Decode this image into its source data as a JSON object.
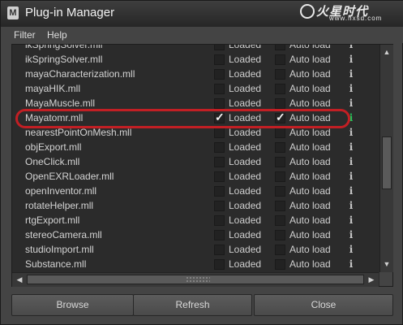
{
  "window": {
    "title": "Plug-in Manager"
  },
  "watermark": {
    "text": "火星时代",
    "url": "www.hxsd.com"
  },
  "menubar": {
    "items": [
      {
        "label": "Filter"
      },
      {
        "label": "Help"
      }
    ]
  },
  "plugins": [
    {
      "name": "ikSpringSolver.mll",
      "loaded": false,
      "auto_load": false,
      "loaded_label": "Loaded",
      "auto_label": "Auto load",
      "info_color": "#c8c8c8"
    },
    {
      "name": "ikSpringSolver.mll",
      "loaded": false,
      "auto_load": false,
      "loaded_label": "Loaded",
      "auto_label": "Auto load",
      "info_color": "#c8c8c8"
    },
    {
      "name": "mayaCharacterization.mll",
      "loaded": false,
      "auto_load": false,
      "loaded_label": "Loaded",
      "auto_label": "Auto load",
      "info_color": "#c8c8c8"
    },
    {
      "name": "mayaHIK.mll",
      "loaded": false,
      "auto_load": false,
      "loaded_label": "Loaded",
      "auto_label": "Auto load",
      "info_color": "#c8c8c8"
    },
    {
      "name": "MayaMuscle.mll",
      "loaded": false,
      "auto_load": false,
      "loaded_label": "Loaded",
      "auto_label": "Auto load",
      "info_color": "#c8c8c8"
    },
    {
      "name": "Mayatomr.mll",
      "loaded": true,
      "auto_load": true,
      "loaded_label": "Loaded",
      "auto_label": "Auto load",
      "info_color": "#22c35a"
    },
    {
      "name": "nearestPointOnMesh.mll",
      "loaded": false,
      "auto_load": false,
      "loaded_label": "Loaded",
      "auto_label": "Auto load",
      "info_color": "#c8c8c8"
    },
    {
      "name": "objExport.mll",
      "loaded": false,
      "auto_load": false,
      "loaded_label": "Loaded",
      "auto_label": "Auto load",
      "info_color": "#c8c8c8"
    },
    {
      "name": "OneClick.mll",
      "loaded": false,
      "auto_load": false,
      "loaded_label": "Loaded",
      "auto_label": "Auto load",
      "info_color": "#c8c8c8"
    },
    {
      "name": "OpenEXRLoader.mll",
      "loaded": false,
      "auto_load": false,
      "loaded_label": "Loaded",
      "auto_label": "Auto load",
      "info_color": "#c8c8c8"
    },
    {
      "name": "openInventor.mll",
      "loaded": false,
      "auto_load": false,
      "loaded_label": "Loaded",
      "auto_label": "Auto load",
      "info_color": "#c8c8c8"
    },
    {
      "name": "rotateHelper.mll",
      "loaded": false,
      "auto_load": false,
      "loaded_label": "Loaded",
      "auto_label": "Auto load",
      "info_color": "#c8c8c8"
    },
    {
      "name": "rtgExport.mll",
      "loaded": false,
      "auto_load": false,
      "loaded_label": "Loaded",
      "auto_label": "Auto load",
      "info_color": "#c8c8c8"
    },
    {
      "name": "stereoCamera.mll",
      "loaded": false,
      "auto_load": false,
      "loaded_label": "Loaded",
      "auto_label": "Auto load",
      "info_color": "#c8c8c8"
    },
    {
      "name": "studioImport.mll",
      "loaded": false,
      "auto_load": false,
      "loaded_label": "Loaded",
      "auto_label": "Auto load",
      "info_color": "#c8c8c8"
    },
    {
      "name": "Substance.mll",
      "loaded": false,
      "auto_load": false,
      "loaded_label": "Loaded",
      "auto_label": "Auto load",
      "info_color": "#c8c8c8"
    }
  ],
  "info_glyph": "i",
  "check_glyph": "✓",
  "buttons": {
    "browse": "Browse",
    "refresh": "Refresh",
    "close": "Close"
  },
  "highlight_color": "#c21f24"
}
